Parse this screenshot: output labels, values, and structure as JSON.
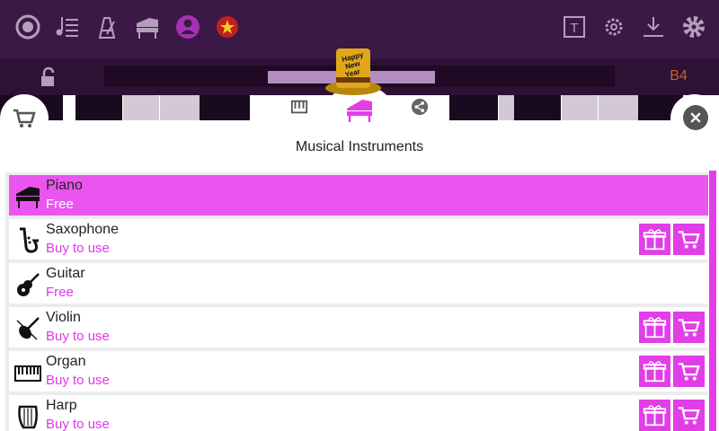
{
  "toolbar": {
    "left_icons": [
      "record-icon",
      "playlist-icon",
      "metronome-icon",
      "piano-icon",
      "profile-icon",
      "language-flag-icon"
    ],
    "right_icons": [
      "text-tool-icon",
      "settings-cog-icon",
      "download-icon",
      "gear-icon"
    ]
  },
  "keyboard": {
    "note_label": "B4"
  },
  "tabs": [
    "piano-keys-tab",
    "instruments-tab",
    "share-tab"
  ],
  "panel": {
    "title": "Musical Instruments"
  },
  "instruments": [
    {
      "name": "Piano",
      "price": "Free",
      "selected": true,
      "buyable": false
    },
    {
      "name": "Saxophone",
      "price": "Buy to use",
      "selected": false,
      "buyable": true
    },
    {
      "name": "Guitar",
      "price": "Free",
      "selected": false,
      "buyable": false
    },
    {
      "name": "Violin",
      "price": "Buy to use",
      "selected": false,
      "buyable": true
    },
    {
      "name": "Organ",
      "price": "Buy to use",
      "selected": false,
      "buyable": true
    },
    {
      "name": "Harp",
      "price": "Buy to use",
      "selected": false,
      "buyable": true
    }
  ],
  "hat_text": "Happy New Year",
  "colors": {
    "accent": "#e23ee8",
    "topbar": "#3b1846",
    "note": "#c8601b"
  }
}
